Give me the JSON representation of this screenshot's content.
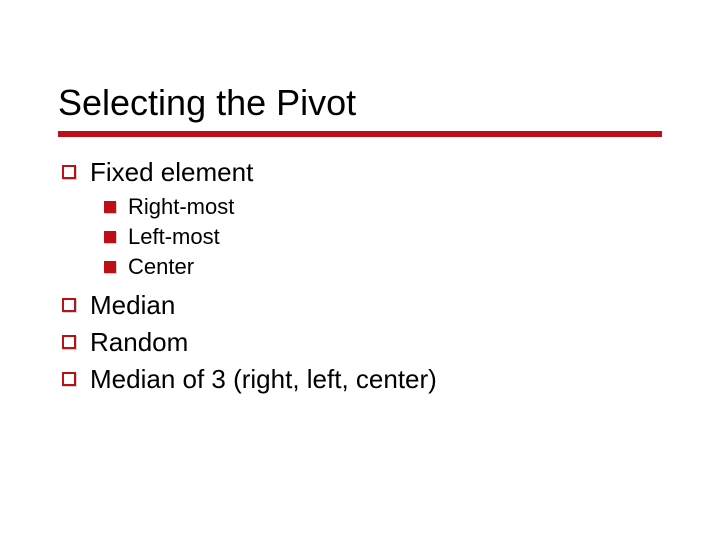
{
  "slide": {
    "title": "Selecting the Pivot",
    "items": [
      {
        "label": "Fixed element",
        "children": [
          {
            "label": "Right-most"
          },
          {
            "label": "Left-most"
          },
          {
            "label": "Center"
          }
        ]
      },
      {
        "label": "Median"
      },
      {
        "label": "Random"
      },
      {
        "label": "Median of 3 (right, left, center)"
      }
    ]
  },
  "colors": {
    "accent": "#BE0F19"
  }
}
